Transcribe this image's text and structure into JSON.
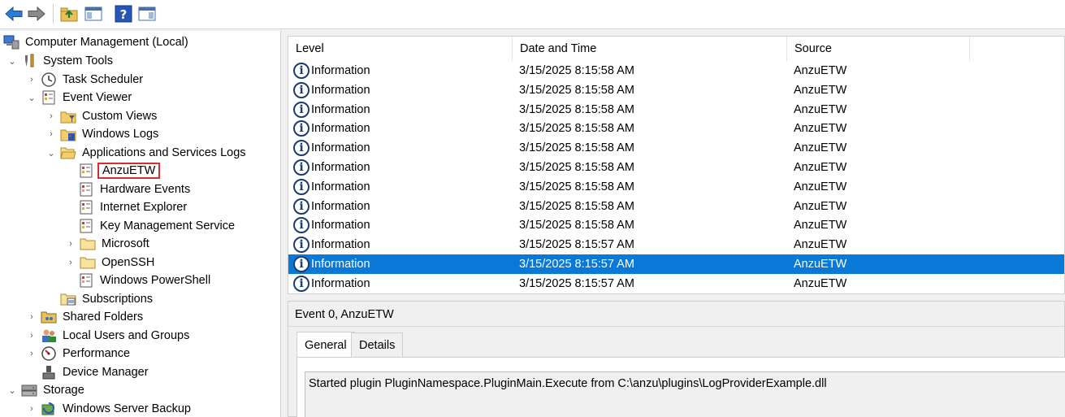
{
  "toolbar": {
    "buttons": [
      "back-icon",
      "forward-icon",
      "up-folder-icon",
      "show-hide-tree-icon",
      "help-icon",
      "show-hide-action-pane-icon"
    ]
  },
  "tree": {
    "root": "Computer Management (Local)",
    "system_tools": "System Tools",
    "task_scheduler": "Task Scheduler",
    "event_viewer": "Event Viewer",
    "custom_views": "Custom Views",
    "windows_logs": "Windows Logs",
    "app_services_logs": "Applications and Services Logs",
    "anzu_etw": "AnzuETW",
    "hardware_events": "Hardware Events",
    "internet_explorer": "Internet Explorer",
    "key_management": "Key Management Service",
    "microsoft": "Microsoft",
    "openssh": "OpenSSH",
    "windows_powershell": "Windows PowerShell",
    "subscriptions": "Subscriptions",
    "shared_folders": "Shared Folders",
    "local_users": "Local Users and Groups",
    "performance": "Performance",
    "device_manager": "Device Manager",
    "storage": "Storage",
    "windows_server_backup": "Windows Server Backup"
  },
  "events": {
    "columns": [
      "Level",
      "Date and Time",
      "Source"
    ],
    "rows": [
      {
        "level": "Information",
        "datetime": "3/15/2025 8:15:58 AM",
        "source": "AnzuETW"
      },
      {
        "level": "Information",
        "datetime": "3/15/2025 8:15:58 AM",
        "source": "AnzuETW"
      },
      {
        "level": "Information",
        "datetime": "3/15/2025 8:15:58 AM",
        "source": "AnzuETW"
      },
      {
        "level": "Information",
        "datetime": "3/15/2025 8:15:58 AM",
        "source": "AnzuETW"
      },
      {
        "level": "Information",
        "datetime": "3/15/2025 8:15:58 AM",
        "source": "AnzuETW"
      },
      {
        "level": "Information",
        "datetime": "3/15/2025 8:15:58 AM",
        "source": "AnzuETW"
      },
      {
        "level": "Information",
        "datetime": "3/15/2025 8:15:58 AM",
        "source": "AnzuETW"
      },
      {
        "level": "Information",
        "datetime": "3/15/2025 8:15:58 AM",
        "source": "AnzuETW"
      },
      {
        "level": "Information",
        "datetime": "3/15/2025 8:15:58 AM",
        "source": "AnzuETW"
      },
      {
        "level": "Information",
        "datetime": "3/15/2025 8:15:57 AM",
        "source": "AnzuETW"
      },
      {
        "level": "Information",
        "datetime": "3/15/2025 8:15:57 AM",
        "source": "AnzuETW"
      },
      {
        "level": "Information",
        "datetime": "3/15/2025 8:15:57 AM",
        "source": "AnzuETW"
      }
    ],
    "selected_index": 10,
    "selection_color": "#0a78d7"
  },
  "detail": {
    "title": "Event 0, AnzuETW",
    "tabs": [
      "General",
      "Details"
    ],
    "active_tab": "General",
    "message": "Started plugin PluginNamespace.PluginMain.Execute from C:\\anzu\\plugins\\LogProviderExample.dll"
  },
  "colors": {
    "highlight_border": "#d32f2f",
    "accent": "#0a78d7"
  }
}
